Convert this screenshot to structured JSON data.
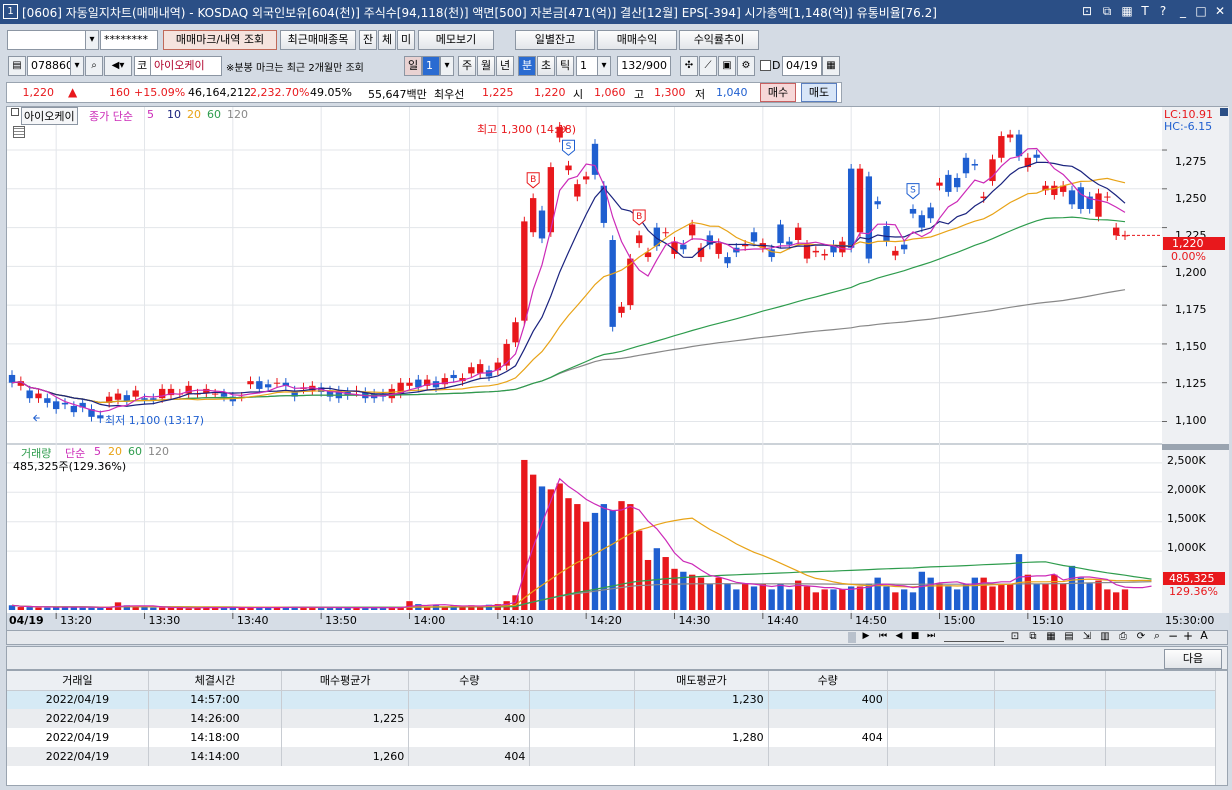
{
  "window": {
    "num": "1",
    "title": "[0606] 자동일지차트(매매내역) - KOSDAQ 외국인보유[604(천)] 주식수[94,118(천)] 액면[500] 자본금[471(억)] 결산[12월] EPS[-394] 시가총액[1,148(억)] 유통비율[76.2]"
  },
  "toolbar1": {
    "account_value": "",
    "password_value": "********",
    "btn_trade_mark": "매매마크/내역 조회",
    "btn_recent": "최근매매종목",
    "btn_jan": "잔",
    "btn_che": "체",
    "btn_mi": "미",
    "btn_memo": "메모보기",
    "btn_daily_balance": "일별잔고",
    "btn_trade_profit": "매매수익",
    "btn_yield_trend": "수익률추이"
  },
  "toolbar2": {
    "code": "078860",
    "market": "코",
    "stock_name": "아이오케이",
    "note": "※분봉 마크는 최근 2개월만 조회",
    "period_il": "일",
    "period_num": "1",
    "period_ju": "주",
    "period_wol": "월",
    "period_nyeon": "년",
    "period_bun": "분",
    "period_cho": "초",
    "period_tick": "틱",
    "interval_value": "1",
    "count": "132/900",
    "date": "04/19",
    "date_check_label": "D"
  },
  "quote": {
    "price": "1,220",
    "arrow": "▲",
    "change": "160",
    "rate": "+15.09%",
    "volume": "46,164,212",
    "vol_rate": "2,232.70%",
    "turnover": "49.05%",
    "amount": "55,647백만",
    "best_label": "최우선",
    "ask": "1,225",
    "bid": "1,220",
    "open_label": "시",
    "open": "1,060",
    "high_label": "고",
    "high": "1,300",
    "low_label": "저",
    "low": "1,040",
    "buy": "매수",
    "sell": "매도"
  },
  "price_chart": {
    "name_box": "아이오케이",
    "legend_title": "종가 단순",
    "ma": [
      "5",
      "10",
      "20",
      "60",
      "120"
    ],
    "lc": "LC:10.91",
    "hc": "HC:-6.15",
    "high_marker": "최고 1,300 (14:18)",
    "low_marker": "최저 1,100 (13:17)",
    "current_price": "1,220",
    "current_rate": "0.00%",
    "y_ticks": [
      "1,275",
      "1,250",
      "1,225",
      "1,200",
      "1,175",
      "1,150",
      "1,125",
      "1,100"
    ]
  },
  "volume_chart": {
    "title": "거래량",
    "legend_title": "단순",
    "ma": [
      "5",
      "20",
      "60",
      "120"
    ],
    "value_text": "485,325주(129.36%)",
    "current_volume": "485,325",
    "current_rate": "129.36%",
    "y_ticks": [
      "2,500K",
      "2,000K",
      "1,500K",
      "1,000K"
    ]
  },
  "x_axis": {
    "date": "04/19",
    "ticks": [
      "13:20",
      "13:30",
      "13:40",
      "13:50",
      "14:00",
      "14:10",
      "14:20",
      "14:30",
      "14:40",
      "14:50",
      "15:00",
      "15:10"
    ],
    "end": "15:30:00"
  },
  "next_button": "다음",
  "table": {
    "headers": [
      "거래일",
      "체결시간",
      "매수평균가",
      "수량",
      "",
      "매도평균가",
      "수량",
      "",
      "",
      ""
    ],
    "rows": [
      [
        "2022/04/19",
        "14:57:00",
        "",
        "",
        "",
        "1,230",
        "400",
        "",
        "",
        ""
      ],
      [
        "2022/04/19",
        "14:26:00",
        "1,225",
        "400",
        "",
        "",
        "",
        "",
        "",
        ""
      ],
      [
        "2022/04/19",
        "14:18:00",
        "",
        "",
        "",
        "1,280",
        "404",
        "",
        "",
        ""
      ],
      [
        "2022/04/19",
        "14:14:00",
        "1,260",
        "404",
        "",
        "",
        "",
        "",
        "",
        ""
      ]
    ]
  },
  "colors": {
    "up": "#e8181c",
    "down": "#1f5fd0",
    "ma5": "#cc2ab8",
    "ma10": "#1a237e",
    "ma20": "#e8a317",
    "ma60": "#2e9c4d",
    "ma120": "#888888"
  },
  "chart_data": {
    "type": "candlestick",
    "price_open": [
      1130,
      1123,
      1120,
      1115,
      1115,
      1113,
      1112,
      1110,
      1112,
      1108,
      1104,
      1112,
      1114,
      1117,
      1116,
      1115,
      1115,
      1115,
      1117,
      1118,
      1118,
      1118,
      1118,
      1118,
      1118,
      1116,
      1116,
      1124,
      1126,
      1124,
      1125,
      1125,
      1120,
      1121,
      1120,
      1122,
      1120,
      1120,
      1119,
      1119,
      1119,
      1118,
      1118,
      1115,
      1118,
      1123,
      1127,
      1123,
      1126,
      1124,
      1130,
      1126,
      1131,
      1131,
      1133,
      1133,
      1136,
      1151,
      1165,
      1222,
      1236,
      1222,
      1283,
      1262,
      1245,
      1256,
      1279,
      1252,
      1217,
      1170,
      1175,
      1215,
      1206,
      1225,
      1222,
      1208,
      1214,
      1220,
      1206,
      1220,
      1208,
      1206,
      1212,
      1213,
      1222,
      1212,
      1211,
      1227,
      1216,
      1217,
      1205,
      1209,
      1207,
      1214,
      1209,
      1263,
      1222,
      1258,
      1242,
      1226,
      1207,
      1214,
      1237,
      1233,
      1238,
      1252,
      1259,
      1257,
      1270,
      1266,
      1244,
      1255,
      1270,
      1283,
      1285,
      1264,
      1272,
      1249,
      1246,
      1248,
      1249,
      1251,
      1245,
      1232,
      1245,
      1220,
      1220
    ],
    "price_close": [
      1125,
      1126,
      1115,
      1118,
      1112,
      1108,
      1111,
      1106,
      1109,
      1103,
      1102,
      1116,
      1118,
      1113,
      1120,
      1114,
      1114,
      1121,
      1121,
      1118,
      1123,
      1118,
      1121,
      1118,
      1116,
      1113,
      1116,
      1126,
      1121,
      1122,
      1125,
      1123,
      1116,
      1122,
      1123,
      1119,
      1116,
      1115,
      1117,
      1120,
      1115,
      1115,
      1116,
      1121,
      1125,
      1125,
      1122,
      1127,
      1122,
      1128,
      1128,
      1128,
      1135,
      1137,
      1129,
      1138,
      1150,
      1164,
      1229,
      1244,
      1218,
      1264,
      1290,
      1265,
      1253,
      1258,
      1259,
      1228,
      1161,
      1174,
      1205,
      1220,
      1209,
      1213,
      1222,
      1216,
      1211,
      1227,
      1212,
      1214,
      1215,
      1202,
      1209,
      1214,
      1216,
      1215,
      1206,
      1215,
      1214,
      1225,
      1214,
      1210,
      1208,
      1209,
      1216,
      1212,
      1263,
      1205,
      1240,
      1216,
      1210,
      1211,
      1234,
      1225,
      1231,
      1254,
      1248,
      1251,
      1260,
      1265,
      1245,
      1269,
      1284,
      1285,
      1271,
      1270,
      1270,
      1252,
      1252,
      1252,
      1240,
      1237,
      1237,
      1247,
      1245,
      1225,
      1220
    ],
    "volume_k": [
      80,
      50,
      50,
      40,
      40,
      60,
      60,
      50,
      40,
      40,
      40,
      50,
      130,
      80,
      50,
      50,
      40,
      40,
      40,
      40,
      30,
      40,
      50,
      40,
      40,
      40,
      40,
      40,
      50,
      40,
      40,
      40,
      60,
      50,
      40,
      40,
      40,
      40,
      40,
      40,
      40,
      40,
      40,
      40,
      40,
      150,
      100,
      60,
      80,
      60,
      80,
      60,
      80,
      60,
      90,
      100,
      150,
      250,
      2550,
      2300,
      2100,
      2050,
      2150,
      1900,
      1800,
      1500,
      1650,
      1800,
      1700,
      1850,
      1800,
      1350,
      850,
      1050,
      900,
      700,
      650,
      600,
      550,
      450,
      550,
      450,
      350,
      450,
      400,
      450,
      350,
      450,
      350,
      500,
      400,
      300,
      350,
      350,
      350,
      400,
      400,
      450,
      550,
      400,
      300,
      350,
      300,
      650,
      550,
      450,
      400,
      350,
      450,
      550,
      550,
      400,
      450,
      450,
      950,
      600,
      450,
      450,
      600,
      450,
      750,
      550,
      450,
      500,
      350,
      300,
      350,
      400,
      500,
      480
    ],
    "high_point": {
      "time": "14:18",
      "price": 1300
    },
    "low_point": {
      "time": "13:17",
      "price": 1100
    },
    "trade_marks": [
      {
        "type": "B",
        "time": "14:14"
      },
      {
        "type": "S",
        "time": "14:18"
      },
      {
        "type": "B",
        "time": "14:26"
      },
      {
        "type": "S",
        "time": "14:57"
      }
    ],
    "ylim_price": [
      1090,
      1295
    ],
    "ylim_volume": [
      0,
      2600
    ]
  }
}
